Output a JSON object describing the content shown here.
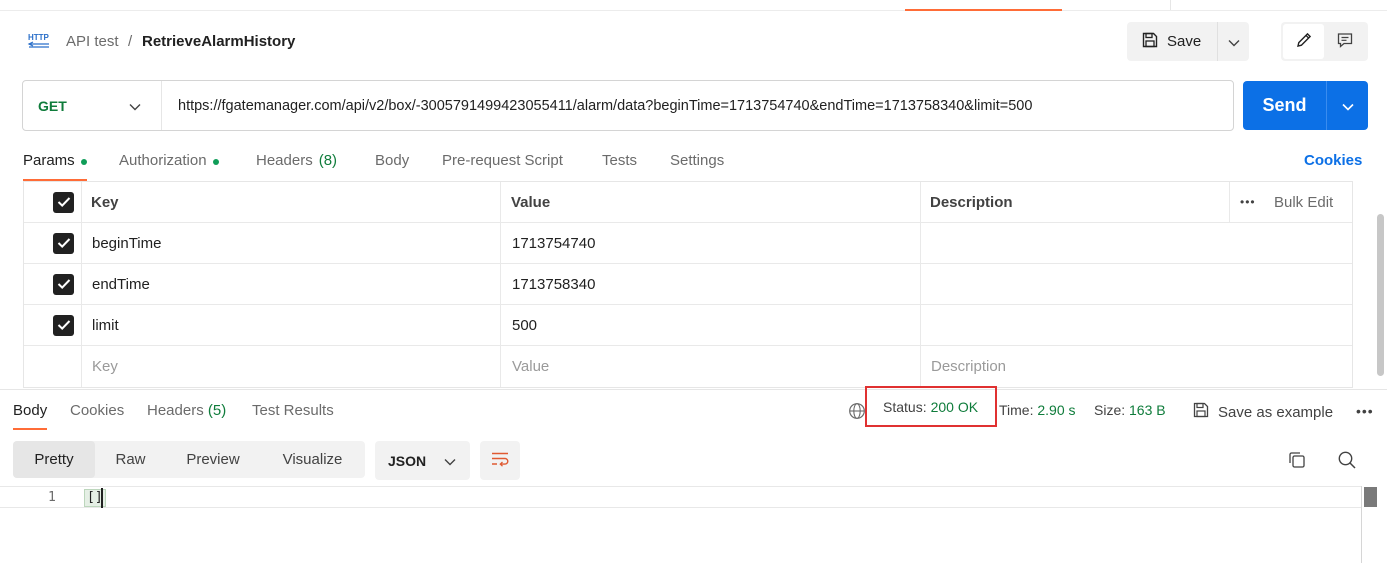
{
  "breadcrumb": {
    "parent": "API test",
    "separator": "/",
    "current": "RetrieveAlarmHistory"
  },
  "header": {
    "save_label": "Save"
  },
  "request": {
    "method": "GET",
    "url": "https://fgatemanager.com/api/v2/box/-3005791499423055411/alarm/data?beginTime=1713754740&endTime=1713758340&limit=500",
    "send_label": "Send"
  },
  "request_tabs": {
    "params": "Params",
    "authorization": "Authorization",
    "headers": "Headers",
    "headers_count": "(8)",
    "body": "Body",
    "prerequest": "Pre-request Script",
    "tests": "Tests",
    "settings": "Settings",
    "cookies": "Cookies"
  },
  "params_table": {
    "col_key": "Key",
    "col_value": "Value",
    "col_description": "Description",
    "bulk_edit": "Bulk Edit",
    "more": "•••",
    "rows": [
      {
        "key": "beginTime",
        "value": "1713754740",
        "checked": true
      },
      {
        "key": "endTime",
        "value": "1713758340",
        "checked": true
      },
      {
        "key": "limit",
        "value": "500",
        "checked": true
      }
    ],
    "placeholder_key": "Key",
    "placeholder_value": "Value",
    "placeholder_description": "Description"
  },
  "response_tabs": {
    "body": "Body",
    "cookies": "Cookies",
    "headers": "Headers",
    "headers_count": "(5)",
    "test_results": "Test Results"
  },
  "response_meta": {
    "status_label": "Status:",
    "status_value": "200 OK",
    "time_label": "Time:",
    "time_value": "2.90 s",
    "size_label": "Size:",
    "size_value": "163 B",
    "save_example": "Save as example",
    "more": "•••"
  },
  "response_view": {
    "modes": [
      "Pretty",
      "Raw",
      "Preview",
      "Visualize"
    ],
    "active_mode": "Pretty",
    "format": "JSON"
  },
  "response_body": {
    "line_number": "1",
    "content": "[]"
  },
  "colors": {
    "accent": "#ff6c37",
    "send": "#0c70e6",
    "status_ok": "#0f7c3b",
    "highlight_box": "#e03131"
  }
}
